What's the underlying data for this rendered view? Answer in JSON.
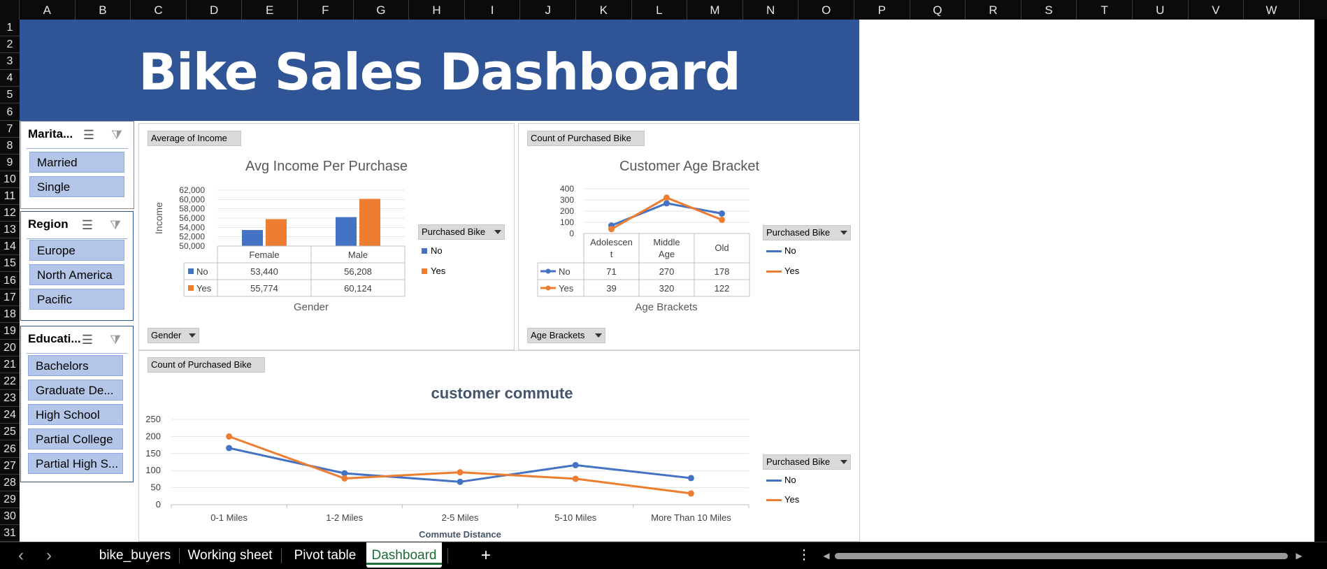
{
  "columns": [
    "A",
    "B",
    "C",
    "D",
    "E",
    "F",
    "G",
    "H",
    "I",
    "J",
    "K",
    "L",
    "M",
    "N",
    "O",
    "P",
    "Q",
    "R",
    "S",
    "T",
    "U",
    "V",
    "W"
  ],
  "rows": [
    "1",
    "2",
    "3",
    "4",
    "5",
    "6",
    "7",
    "8",
    "9",
    "10",
    "11",
    "12",
    "13",
    "14",
    "15",
    "16",
    "17",
    "18",
    "19",
    "20",
    "21",
    "22",
    "23",
    "24",
    "25",
    "26",
    "27",
    "28",
    "29",
    "30",
    "31"
  ],
  "banner": {
    "title": "Bike Sales Dashboard"
  },
  "slicers": {
    "marital": {
      "title": "Marita...",
      "items": [
        "Married",
        "Single"
      ]
    },
    "region": {
      "title": "Region",
      "items": [
        "Europe",
        "North America",
        "Pacific"
      ]
    },
    "education": {
      "title": "Educati...",
      "items": [
        "Bachelors",
        "Graduate De...",
        "High School",
        "Partial College",
        "Partial High S..."
      ]
    }
  },
  "charts": {
    "income": {
      "value_button": "Average of Income",
      "axis_button": "Gender",
      "legend_button": "Purchased Bike",
      "legend": [
        "No",
        "Yes"
      ]
    },
    "age": {
      "value_button": "Count of Purchased Bike",
      "axis_button": "Age Brackets",
      "legend_button": "Purchased Bike",
      "legend": [
        "No",
        "Yes"
      ]
    },
    "commute": {
      "value_button": "Count of Purchased Bike",
      "legend_button": "Purchased Bike",
      "legend": [
        "No",
        "Yes"
      ]
    }
  },
  "chart_data": [
    {
      "type": "bar",
      "title": "Avg Income Per Purchase",
      "xlabel": "Gender",
      "ylabel": "Income",
      "categories": [
        "Female",
        "Male"
      ],
      "series": [
        {
          "name": "No",
          "values": [
            53440,
            56208
          ],
          "labels": [
            "53,440",
            "56,208"
          ],
          "color": "#4472c4"
        },
        {
          "name": "Yes",
          "values": [
            55774,
            60124
          ],
          "labels": [
            "55,774",
            "60,124"
          ],
          "color": "#ed7d31"
        }
      ],
      "ylim": [
        50000,
        62000
      ],
      "yticks": [
        "62,000",
        "60,000",
        "58,000",
        "56,000",
        "54,000",
        "52,000",
        "50,000"
      ],
      "legend": "right",
      "data_table": true
    },
    {
      "type": "line",
      "title": "Customer Age Bracket",
      "xlabel": "Age Brackets",
      "categories": [
        "Adolescent",
        "Middle Age",
        "Old"
      ],
      "category_lines": [
        [
          "Adolescen",
          "t"
        ],
        [
          "Middle",
          "Age"
        ],
        [
          "Old"
        ]
      ],
      "series": [
        {
          "name": "No",
          "values": [
            71,
            270,
            178
          ],
          "color": "#4472c4"
        },
        {
          "name": "Yes",
          "values": [
            39,
            320,
            122
          ],
          "color": "#ed7d31"
        }
      ],
      "ylim": [
        0,
        400
      ],
      "yticks": [
        "400",
        "300",
        "200",
        "100",
        "0"
      ],
      "legend": "right",
      "data_table": true
    },
    {
      "type": "line",
      "title": "customer commute",
      "xlabel": "Commute Distance",
      "categories": [
        "0-1 Miles",
        "1-2 Miles",
        "2-5 Miles",
        "5-10 Miles",
        "More Than 10 Miles"
      ],
      "series": [
        {
          "name": "No",
          "values": [
            166,
            92,
            67,
            116,
            78
          ],
          "color": "#4472c4"
        },
        {
          "name": "Yes",
          "values": [
            200,
            77,
            95,
            76,
            33
          ],
          "color": "#ed7d31"
        }
      ],
      "ylim": [
        0,
        250
      ],
      "yticks": [
        "250",
        "200",
        "150",
        "100",
        "50",
        "0"
      ],
      "legend": "right"
    }
  ],
  "tabs": {
    "items": [
      "bike_buyers",
      "Working sheet",
      "Pivot table",
      "Dashboard"
    ],
    "active": "Dashboard",
    "prev": "‹",
    "next": "›",
    "add": "+",
    "more": "⋮",
    "scroll_left": "◀",
    "scroll_right": "▶"
  },
  "colors": {
    "banner": "#2f5597",
    "no": "#4472c4",
    "yes": "#ed7d31",
    "slicer_item": "#b4c6e7"
  }
}
